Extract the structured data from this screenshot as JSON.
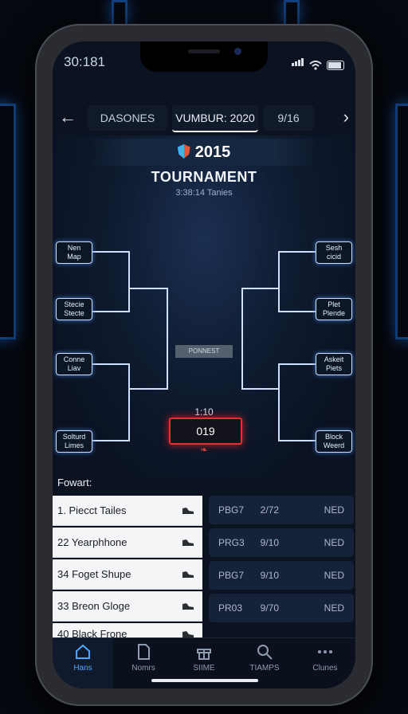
{
  "status": {
    "time": "30:181"
  },
  "nav": {
    "tabs": [
      "DASONES",
      "VUMBUR: 2020",
      "9/16"
    ],
    "active_index": 1
  },
  "header": {
    "year": "2015",
    "title": "TOURNAMENT",
    "subtitle": "3:38:14 Tanies"
  },
  "bracket": {
    "left_teams": [
      "Nen\nMap",
      "Stecie\nStecte",
      "Conne\nLiav",
      "Solturd\nLimes"
    ],
    "right_teams": [
      "Sesh\ncicid",
      "Plet\nPlende",
      "Askeit\nPiets",
      "Block\nWeerd"
    ],
    "center_label": "PONNEST",
    "clock": "1:10",
    "score": "019"
  },
  "format_label": "Fowart:",
  "left_list": [
    {
      "text": "1. Piecct Tailes",
      "icon": "shoe-icon"
    },
    {
      "text": "22 Yearphhone",
      "icon": "shoe-icon"
    },
    {
      "text": "34 Foget Shupe",
      "icon": "shoe-icon"
    },
    {
      "text": "33 Breon Gloge",
      "icon": "shoe-icon"
    },
    {
      "text": "40 Black Frone",
      "icon": "shoe-icon"
    }
  ],
  "right_list": [
    {
      "a": "PBG7",
      "b": "2/72",
      "c": "NED"
    },
    {
      "a": "PRG3",
      "b": "9/10",
      "c": "NED"
    },
    {
      "a": "PBG7",
      "b": "9/10",
      "c": "NED"
    },
    {
      "a": "PR03",
      "b": "9/70",
      "c": "NED"
    }
  ],
  "tabbar": [
    {
      "label": "Hans",
      "icon": "home-icon"
    },
    {
      "label": "Nomrs",
      "icon": "document-icon"
    },
    {
      "label": "SIIME",
      "icon": "gift-icon"
    },
    {
      "label": "TIAMPS",
      "icon": "search-icon"
    },
    {
      "label": "Clunes",
      "icon": "more-icon"
    }
  ],
  "colors": {
    "accent": "#4aa6ff",
    "score_border": "#e23030",
    "bracket_line": "#cfe0ff"
  }
}
